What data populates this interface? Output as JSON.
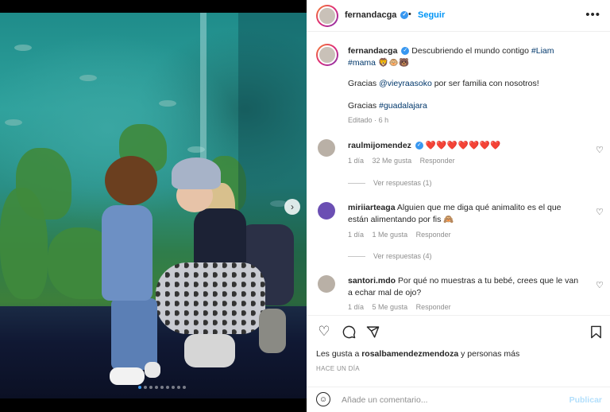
{
  "post": {
    "username": "fernandacga",
    "follow_label": "Seguir",
    "separator": "•",
    "more_icon": "more-horizontal-icon",
    "caption": {
      "text": "Descubriendo el mundo contigo",
      "tag1": "#Liam",
      "tag2": "#mama",
      "emojis": "🦁🐵🐻",
      "line2_prefix": "Gracias",
      "line2_mention": "@vieyraasoko",
      "line2_suffix": "por ser familia con nosotros!",
      "line3_prefix": "Gracias",
      "line3_tag": "#guadalajara",
      "edited": "Editado",
      "edited_sep": "·",
      "edited_time": "6 h"
    },
    "carousel": {
      "total": 9,
      "active_index": 0
    }
  },
  "comments": [
    {
      "username": "raulmijomendez",
      "verified": true,
      "text": "❤️❤️❤️❤️❤️❤️❤️",
      "time": "1 día",
      "likes": "32 Me gusta",
      "reply_label": "Responder",
      "view_replies": "Ver respuestas (1)"
    },
    {
      "username": "miriiarteaga",
      "verified": false,
      "text": "Alguien que me diga qué animalito es el que están alimentando por fis 🙈",
      "time": "1 día",
      "likes": "1 Me gusta",
      "reply_label": "Responder",
      "view_replies": "Ver respuestas (4)"
    },
    {
      "username": "santori.mdo",
      "verified": false,
      "text": "Por qué no muestras a tu bebé, crees que le van a echar mal de ojo?",
      "time": "1 día",
      "likes": "5 Me gusta",
      "reply_label": "Responder"
    }
  ],
  "actions": {
    "likes_text": "Les gusta a",
    "likes_user": "rosalbamendezmendoza",
    "likes_suffix": "y personas más",
    "timestamp": "HACE UN DÍA"
  },
  "add_comment": {
    "placeholder": "Añade un comentario...",
    "publish_label": "Publicar"
  },
  "colors": {
    "accent": "#0095f6",
    "heart": "#ed4956",
    "muted": "#8e8e8e"
  }
}
